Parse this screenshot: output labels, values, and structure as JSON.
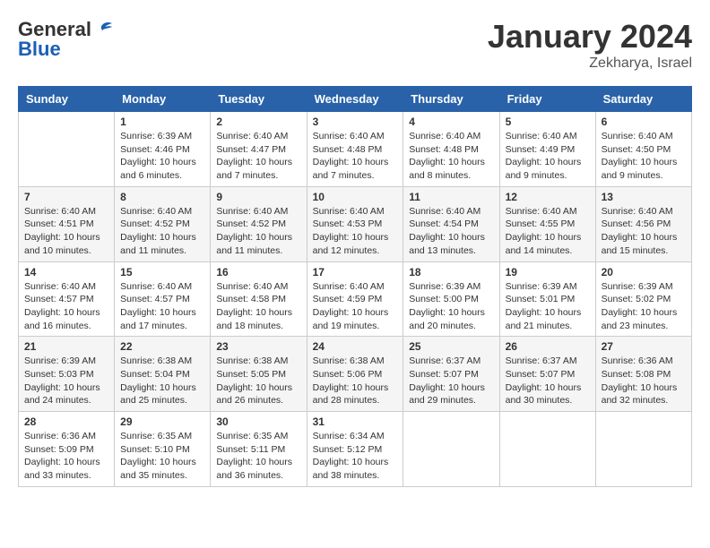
{
  "header": {
    "logo_general": "General",
    "logo_blue": "Blue",
    "month": "January 2024",
    "location": "Zekharya, Israel"
  },
  "days_of_week": [
    "Sunday",
    "Monday",
    "Tuesday",
    "Wednesday",
    "Thursday",
    "Friday",
    "Saturday"
  ],
  "weeks": [
    [
      {
        "day": "",
        "info": ""
      },
      {
        "day": "1",
        "info": "Sunrise: 6:39 AM\nSunset: 4:46 PM\nDaylight: 10 hours\nand 6 minutes."
      },
      {
        "day": "2",
        "info": "Sunrise: 6:40 AM\nSunset: 4:47 PM\nDaylight: 10 hours\nand 7 minutes."
      },
      {
        "day": "3",
        "info": "Sunrise: 6:40 AM\nSunset: 4:48 PM\nDaylight: 10 hours\nand 7 minutes."
      },
      {
        "day": "4",
        "info": "Sunrise: 6:40 AM\nSunset: 4:48 PM\nDaylight: 10 hours\nand 8 minutes."
      },
      {
        "day": "5",
        "info": "Sunrise: 6:40 AM\nSunset: 4:49 PM\nDaylight: 10 hours\nand 9 minutes."
      },
      {
        "day": "6",
        "info": "Sunrise: 6:40 AM\nSunset: 4:50 PM\nDaylight: 10 hours\nand 9 minutes."
      }
    ],
    [
      {
        "day": "7",
        "info": "Sunrise: 6:40 AM\nSunset: 4:51 PM\nDaylight: 10 hours\nand 10 minutes."
      },
      {
        "day": "8",
        "info": "Sunrise: 6:40 AM\nSunset: 4:52 PM\nDaylight: 10 hours\nand 11 minutes."
      },
      {
        "day": "9",
        "info": "Sunrise: 6:40 AM\nSunset: 4:52 PM\nDaylight: 10 hours\nand 11 minutes."
      },
      {
        "day": "10",
        "info": "Sunrise: 6:40 AM\nSunset: 4:53 PM\nDaylight: 10 hours\nand 12 minutes."
      },
      {
        "day": "11",
        "info": "Sunrise: 6:40 AM\nSunset: 4:54 PM\nDaylight: 10 hours\nand 13 minutes."
      },
      {
        "day": "12",
        "info": "Sunrise: 6:40 AM\nSunset: 4:55 PM\nDaylight: 10 hours\nand 14 minutes."
      },
      {
        "day": "13",
        "info": "Sunrise: 6:40 AM\nSunset: 4:56 PM\nDaylight: 10 hours\nand 15 minutes."
      }
    ],
    [
      {
        "day": "14",
        "info": "Sunrise: 6:40 AM\nSunset: 4:57 PM\nDaylight: 10 hours\nand 16 minutes."
      },
      {
        "day": "15",
        "info": "Sunrise: 6:40 AM\nSunset: 4:57 PM\nDaylight: 10 hours\nand 17 minutes."
      },
      {
        "day": "16",
        "info": "Sunrise: 6:40 AM\nSunset: 4:58 PM\nDaylight: 10 hours\nand 18 minutes."
      },
      {
        "day": "17",
        "info": "Sunrise: 6:40 AM\nSunset: 4:59 PM\nDaylight: 10 hours\nand 19 minutes."
      },
      {
        "day": "18",
        "info": "Sunrise: 6:39 AM\nSunset: 5:00 PM\nDaylight: 10 hours\nand 20 minutes."
      },
      {
        "day": "19",
        "info": "Sunrise: 6:39 AM\nSunset: 5:01 PM\nDaylight: 10 hours\nand 21 minutes."
      },
      {
        "day": "20",
        "info": "Sunrise: 6:39 AM\nSunset: 5:02 PM\nDaylight: 10 hours\nand 23 minutes."
      }
    ],
    [
      {
        "day": "21",
        "info": "Sunrise: 6:39 AM\nSunset: 5:03 PM\nDaylight: 10 hours\nand 24 minutes."
      },
      {
        "day": "22",
        "info": "Sunrise: 6:38 AM\nSunset: 5:04 PM\nDaylight: 10 hours\nand 25 minutes."
      },
      {
        "day": "23",
        "info": "Sunrise: 6:38 AM\nSunset: 5:05 PM\nDaylight: 10 hours\nand 26 minutes."
      },
      {
        "day": "24",
        "info": "Sunrise: 6:38 AM\nSunset: 5:06 PM\nDaylight: 10 hours\nand 28 minutes."
      },
      {
        "day": "25",
        "info": "Sunrise: 6:37 AM\nSunset: 5:07 PM\nDaylight: 10 hours\nand 29 minutes."
      },
      {
        "day": "26",
        "info": "Sunrise: 6:37 AM\nSunset: 5:07 PM\nDaylight: 10 hours\nand 30 minutes."
      },
      {
        "day": "27",
        "info": "Sunrise: 6:36 AM\nSunset: 5:08 PM\nDaylight: 10 hours\nand 32 minutes."
      }
    ],
    [
      {
        "day": "28",
        "info": "Sunrise: 6:36 AM\nSunset: 5:09 PM\nDaylight: 10 hours\nand 33 minutes."
      },
      {
        "day": "29",
        "info": "Sunrise: 6:35 AM\nSunset: 5:10 PM\nDaylight: 10 hours\nand 35 minutes."
      },
      {
        "day": "30",
        "info": "Sunrise: 6:35 AM\nSunset: 5:11 PM\nDaylight: 10 hours\nand 36 minutes."
      },
      {
        "day": "31",
        "info": "Sunrise: 6:34 AM\nSunset: 5:12 PM\nDaylight: 10 hours\nand 38 minutes."
      },
      {
        "day": "",
        "info": ""
      },
      {
        "day": "",
        "info": ""
      },
      {
        "day": "",
        "info": ""
      }
    ]
  ]
}
